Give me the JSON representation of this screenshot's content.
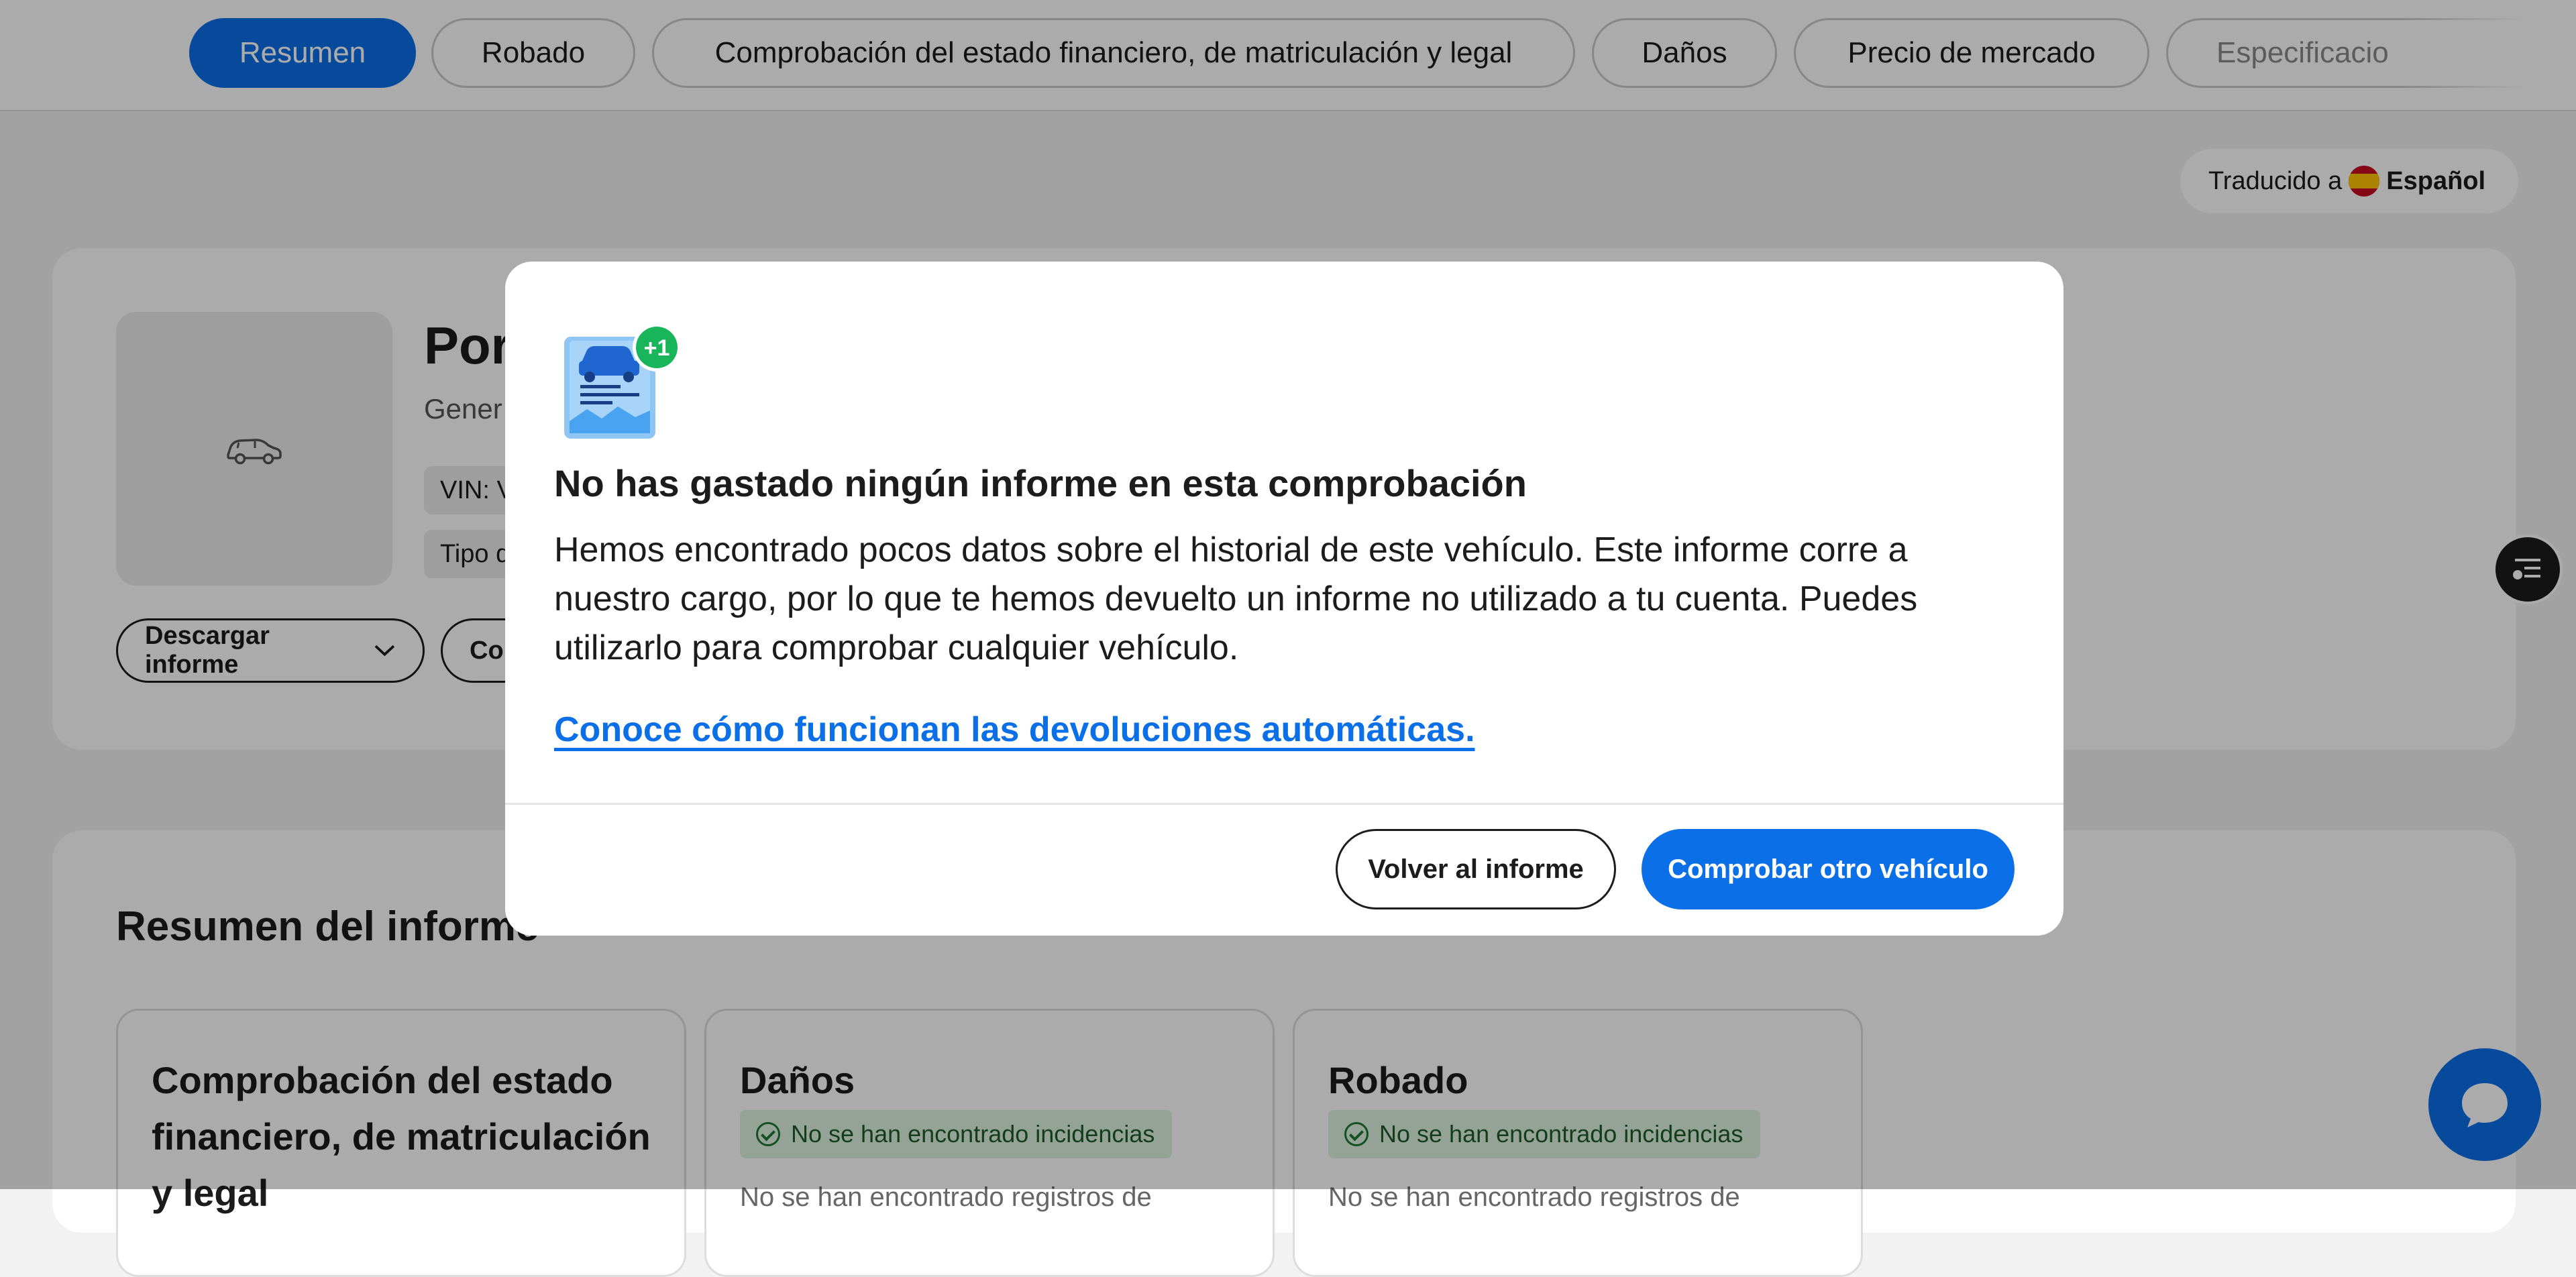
{
  "tabs": [
    {
      "label": "Resumen",
      "active": true
    },
    {
      "label": "Robado"
    },
    {
      "label": "Comprobación del estado financiero, de matriculación y legal"
    },
    {
      "label": "Daños"
    },
    {
      "label": "Precio de mercado"
    },
    {
      "label": "Especificacio"
    }
  ],
  "translation": {
    "prefix": "Traducido a",
    "language": "Español"
  },
  "vehicle": {
    "title": "Por",
    "subtitle": "Gener",
    "vin_label": "VIN: V",
    "type_label": "Tipo d",
    "download_label": "Descargar informe",
    "second_button_label": "Co"
  },
  "summary": {
    "title": "Resumen del informe",
    "cards": [
      {
        "title": "Comprobación del estado financiero, de matriculación y legal",
        "badge": "",
        "text": ""
      },
      {
        "title": "Daños",
        "badge": "No se han encontrado incidencias",
        "text": "No se han encontrado registros de"
      },
      {
        "title": "Robado",
        "badge": "No se han encontrado incidencias",
        "text": "No se han encontrado registros de"
      }
    ]
  },
  "modal": {
    "icon_badge": "+1",
    "title": "No has gastado ningún informe en esta comprobación",
    "body": "Hemos encontrado pocos datos sobre el historial de este vehículo. Este informe corre a nuestro cargo, por lo que te hemos devuelto un informe no utilizado a tu cuenta. Puedes utilizarlo para comprobar cualquier vehículo.",
    "link": "Conoce cómo funcionan las devoluciones automáticas.",
    "secondary_button": "Volver al informe",
    "primary_button": "Comprobar otro vehículo"
  },
  "colors": {
    "accent": "#0b6fe8",
    "success_bg": "#dff3e0",
    "success": "#1d7a33"
  },
  "icons": [
    "car-icon",
    "chevron-down-icon",
    "check-circle-icon",
    "list-menu-icon",
    "chat-icon",
    "report-icon"
  ]
}
